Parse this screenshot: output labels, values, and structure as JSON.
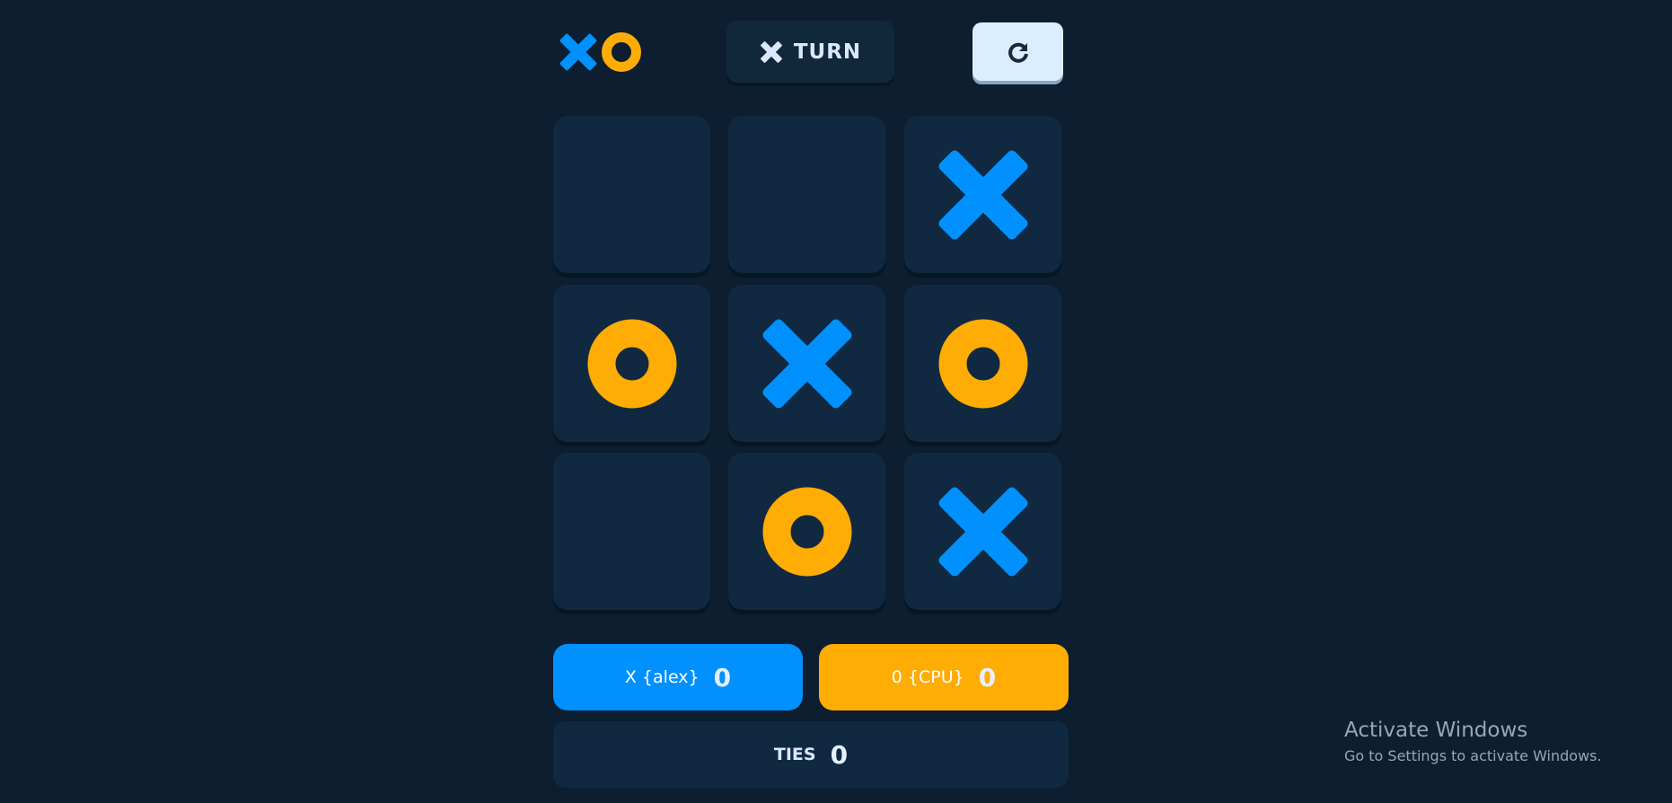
{
  "header": {
    "turn_label": "TURN",
    "turn_icon": "x-icon",
    "restart_icon": "restart-icon"
  },
  "board": {
    "cells": [
      "",
      "",
      "X",
      "O",
      "X",
      "O",
      "",
      "O",
      "X"
    ]
  },
  "scores": {
    "x_label": "X {alex}",
    "x_value": "0",
    "o_label": "0 {CPU}",
    "o_value": "0",
    "ties_label": "TIES",
    "ties_value": "0"
  },
  "watermark": {
    "title": "Activate Windows",
    "subtitle": "Go to Settings to activate Windows."
  },
  "colors": {
    "background": "#0c1e30",
    "x_mark": "#0091ff",
    "o_mark": "#ffac05",
    "cell": "#102940",
    "restart_button": "#dbeeff"
  }
}
